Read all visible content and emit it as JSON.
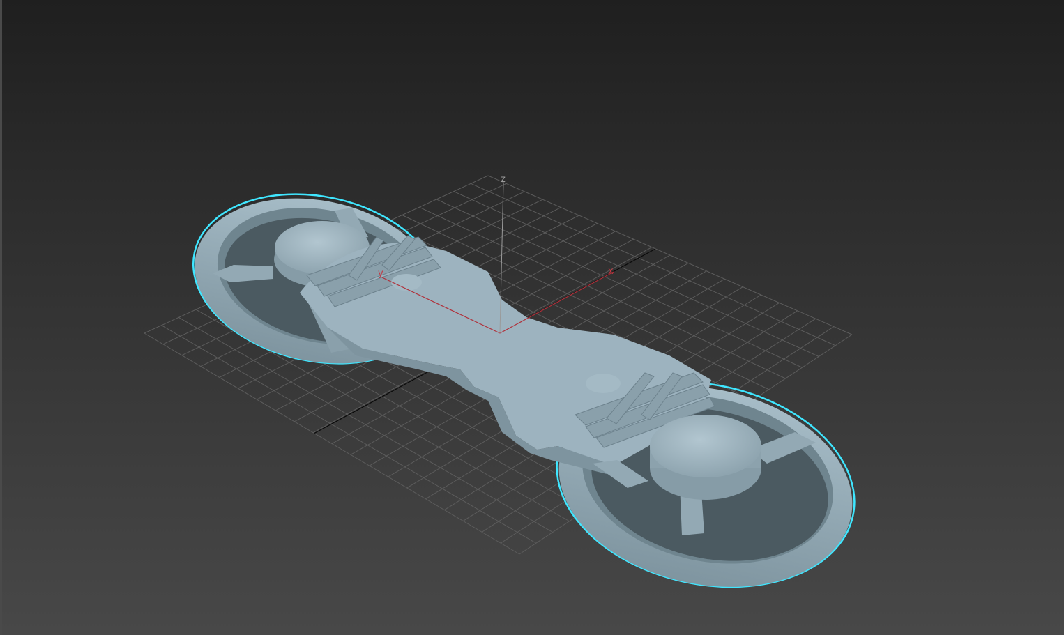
{
  "viewport": {
    "axis_labels": {
      "x": "x",
      "y": "y",
      "z": "z"
    },
    "colors": {
      "background_top": "#1f1f1f",
      "background_bottom": "#484848",
      "grid": "#5c5c5c",
      "world_axis": "#0a0a0a",
      "local_axis": "#b0303a",
      "z_axis": "#9a9a9a",
      "model_fill": "#9db3bf",
      "model_shadow": "#7e949f",
      "model_dark": "#6d828d",
      "selection_outline": "#3fe6ff"
    },
    "selected_object": {
      "type": "mesh",
      "shape": "dual-wheel fidget spinner",
      "selected": true
    }
  }
}
